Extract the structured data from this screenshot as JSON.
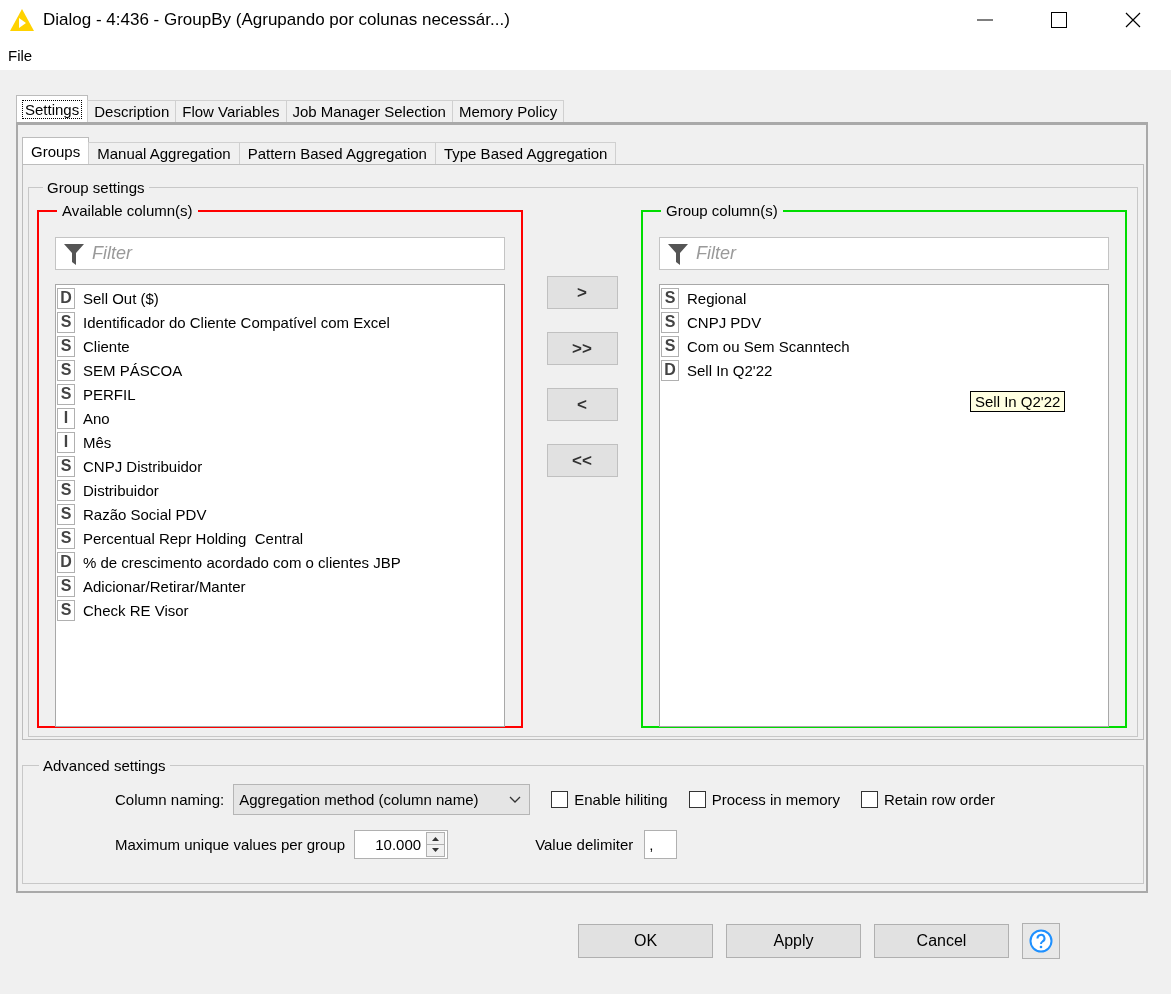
{
  "window": {
    "title": "Dialog - 4:436 - GroupBy (Agrupando por colunas necessár...)"
  },
  "menu": [
    "File"
  ],
  "tabs": [
    {
      "label": "Settings",
      "selected": true
    },
    {
      "label": "Description",
      "selected": false
    },
    {
      "label": "Flow Variables",
      "selected": false
    },
    {
      "label": "Job Manager Selection",
      "selected": false
    },
    {
      "label": "Memory Policy",
      "selected": false
    }
  ],
  "sub_tabs": [
    {
      "label": "Groups",
      "selected": true
    },
    {
      "label": "Manual Aggregation",
      "selected": false
    },
    {
      "label": "Pattern Based Aggregation",
      "selected": false
    },
    {
      "label": "Type Based Aggregation",
      "selected": false
    }
  ],
  "group_settings": {
    "title": "Group settings",
    "available": {
      "title": "Available column(s)",
      "color": "#ff0000",
      "filter_placeholder": "Filter",
      "columns": [
        {
          "type": "D",
          "name": "Sell Out ($)"
        },
        {
          "type": "S",
          "name": "Identificador do Cliente Compatível com Excel"
        },
        {
          "type": "S",
          "name": "Cliente"
        },
        {
          "type": "S",
          "name": "SEM PÁSCOA"
        },
        {
          "type": "S",
          "name": "PERFIL"
        },
        {
          "type": "I",
          "name": "Ano"
        },
        {
          "type": "I",
          "name": "Mês"
        },
        {
          "type": "S",
          "name": "CNPJ Distribuidor"
        },
        {
          "type": "S",
          "name": "Distribuidor"
        },
        {
          "type": "S",
          "name": "Razão Social PDV"
        },
        {
          "type": "S",
          "name": "Percentual Repr Holding  Central"
        },
        {
          "type": "D",
          "name": "% de crescimento acordado com o clientes JBP"
        },
        {
          "type": "S",
          "name": "Adicionar/Retirar/Manter"
        },
        {
          "type": "S",
          "name": "Check RE Visor"
        }
      ]
    },
    "move_buttons": [
      ">",
      ">>",
      "<",
      "<<"
    ],
    "group": {
      "title": "Group column(s)",
      "color": "#00dd00",
      "filter_placeholder": "Filter",
      "columns": [
        {
          "type": "S",
          "name": "Regional"
        },
        {
          "type": "S",
          "name": "CNPJ PDV"
        },
        {
          "type": "S",
          "name": "Com ou Sem Scanntech"
        },
        {
          "type": "D",
          "name": "Sell In Q2'22"
        }
      ],
      "tooltip": "Sell In Q2'22"
    }
  },
  "advanced_settings": {
    "title": "Advanced settings",
    "column_naming": {
      "label": "Column naming:",
      "value": "Aggregation method (column name)"
    },
    "checkboxes": [
      {
        "label": "Enable hiliting",
        "checked": false
      },
      {
        "label": "Process in memory",
        "checked": false
      },
      {
        "label": "Retain row order",
        "checked": false
      }
    ],
    "max_unique": {
      "label": "Maximum unique values per group",
      "value": "10.000"
    },
    "value_delimiter": {
      "label": "Value delimiter",
      "value": ","
    }
  },
  "buttons": [
    "OK",
    "Apply",
    "Cancel"
  ]
}
